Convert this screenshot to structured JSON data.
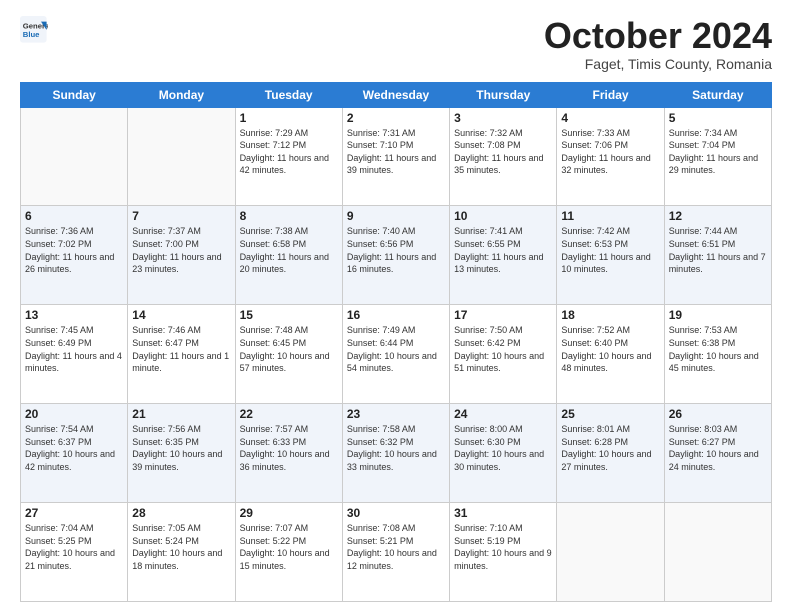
{
  "header": {
    "logo_general": "General",
    "logo_blue": "Blue",
    "month_title": "October 2024",
    "subtitle": "Faget, Timis County, Romania"
  },
  "days_of_week": [
    "Sunday",
    "Monday",
    "Tuesday",
    "Wednesday",
    "Thursday",
    "Friday",
    "Saturday"
  ],
  "weeks": [
    [
      {
        "day": "",
        "info": ""
      },
      {
        "day": "",
        "info": ""
      },
      {
        "day": "1",
        "sunrise": "7:29 AM",
        "sunset": "7:12 PM",
        "daylight": "11 hours and 42 minutes."
      },
      {
        "day": "2",
        "sunrise": "7:31 AM",
        "sunset": "7:10 PM",
        "daylight": "11 hours and 39 minutes."
      },
      {
        "day": "3",
        "sunrise": "7:32 AM",
        "sunset": "7:08 PM",
        "daylight": "11 hours and 35 minutes."
      },
      {
        "day": "4",
        "sunrise": "7:33 AM",
        "sunset": "7:06 PM",
        "daylight": "11 hours and 32 minutes."
      },
      {
        "day": "5",
        "sunrise": "7:34 AM",
        "sunset": "7:04 PM",
        "daylight": "11 hours and 29 minutes."
      }
    ],
    [
      {
        "day": "6",
        "sunrise": "7:36 AM",
        "sunset": "7:02 PM",
        "daylight": "11 hours and 26 minutes."
      },
      {
        "day": "7",
        "sunrise": "7:37 AM",
        "sunset": "7:00 PM",
        "daylight": "11 hours and 23 minutes."
      },
      {
        "day": "8",
        "sunrise": "7:38 AM",
        "sunset": "6:58 PM",
        "daylight": "11 hours and 20 minutes."
      },
      {
        "day": "9",
        "sunrise": "7:40 AM",
        "sunset": "6:56 PM",
        "daylight": "11 hours and 16 minutes."
      },
      {
        "day": "10",
        "sunrise": "7:41 AM",
        "sunset": "6:55 PM",
        "daylight": "11 hours and 13 minutes."
      },
      {
        "day": "11",
        "sunrise": "7:42 AM",
        "sunset": "6:53 PM",
        "daylight": "11 hours and 10 minutes."
      },
      {
        "day": "12",
        "sunrise": "7:44 AM",
        "sunset": "6:51 PM",
        "daylight": "11 hours and 7 minutes."
      }
    ],
    [
      {
        "day": "13",
        "sunrise": "7:45 AM",
        "sunset": "6:49 PM",
        "daylight": "11 hours and 4 minutes."
      },
      {
        "day": "14",
        "sunrise": "7:46 AM",
        "sunset": "6:47 PM",
        "daylight": "11 hours and 1 minute."
      },
      {
        "day": "15",
        "sunrise": "7:48 AM",
        "sunset": "6:45 PM",
        "daylight": "10 hours and 57 minutes."
      },
      {
        "day": "16",
        "sunrise": "7:49 AM",
        "sunset": "6:44 PM",
        "daylight": "10 hours and 54 minutes."
      },
      {
        "day": "17",
        "sunrise": "7:50 AM",
        "sunset": "6:42 PM",
        "daylight": "10 hours and 51 minutes."
      },
      {
        "day": "18",
        "sunrise": "7:52 AM",
        "sunset": "6:40 PM",
        "daylight": "10 hours and 48 minutes."
      },
      {
        "day": "19",
        "sunrise": "7:53 AM",
        "sunset": "6:38 PM",
        "daylight": "10 hours and 45 minutes."
      }
    ],
    [
      {
        "day": "20",
        "sunrise": "7:54 AM",
        "sunset": "6:37 PM",
        "daylight": "10 hours and 42 minutes."
      },
      {
        "day": "21",
        "sunrise": "7:56 AM",
        "sunset": "6:35 PM",
        "daylight": "10 hours and 39 minutes."
      },
      {
        "day": "22",
        "sunrise": "7:57 AM",
        "sunset": "6:33 PM",
        "daylight": "10 hours and 36 minutes."
      },
      {
        "day": "23",
        "sunrise": "7:58 AM",
        "sunset": "6:32 PM",
        "daylight": "10 hours and 33 minutes."
      },
      {
        "day": "24",
        "sunrise": "8:00 AM",
        "sunset": "6:30 PM",
        "daylight": "10 hours and 30 minutes."
      },
      {
        "day": "25",
        "sunrise": "8:01 AM",
        "sunset": "6:28 PM",
        "daylight": "10 hours and 27 minutes."
      },
      {
        "day": "26",
        "sunrise": "8:03 AM",
        "sunset": "6:27 PM",
        "daylight": "10 hours and 24 minutes."
      }
    ],
    [
      {
        "day": "27",
        "sunrise": "7:04 AM",
        "sunset": "5:25 PM",
        "daylight": "10 hours and 21 minutes."
      },
      {
        "day": "28",
        "sunrise": "7:05 AM",
        "sunset": "5:24 PM",
        "daylight": "10 hours and 18 minutes."
      },
      {
        "day": "29",
        "sunrise": "7:07 AM",
        "sunset": "5:22 PM",
        "daylight": "10 hours and 15 minutes."
      },
      {
        "day": "30",
        "sunrise": "7:08 AM",
        "sunset": "5:21 PM",
        "daylight": "10 hours and 12 minutes."
      },
      {
        "day": "31",
        "sunrise": "7:10 AM",
        "sunset": "5:19 PM",
        "daylight": "10 hours and 9 minutes."
      },
      {
        "day": "",
        "info": ""
      },
      {
        "day": "",
        "info": ""
      }
    ]
  ]
}
